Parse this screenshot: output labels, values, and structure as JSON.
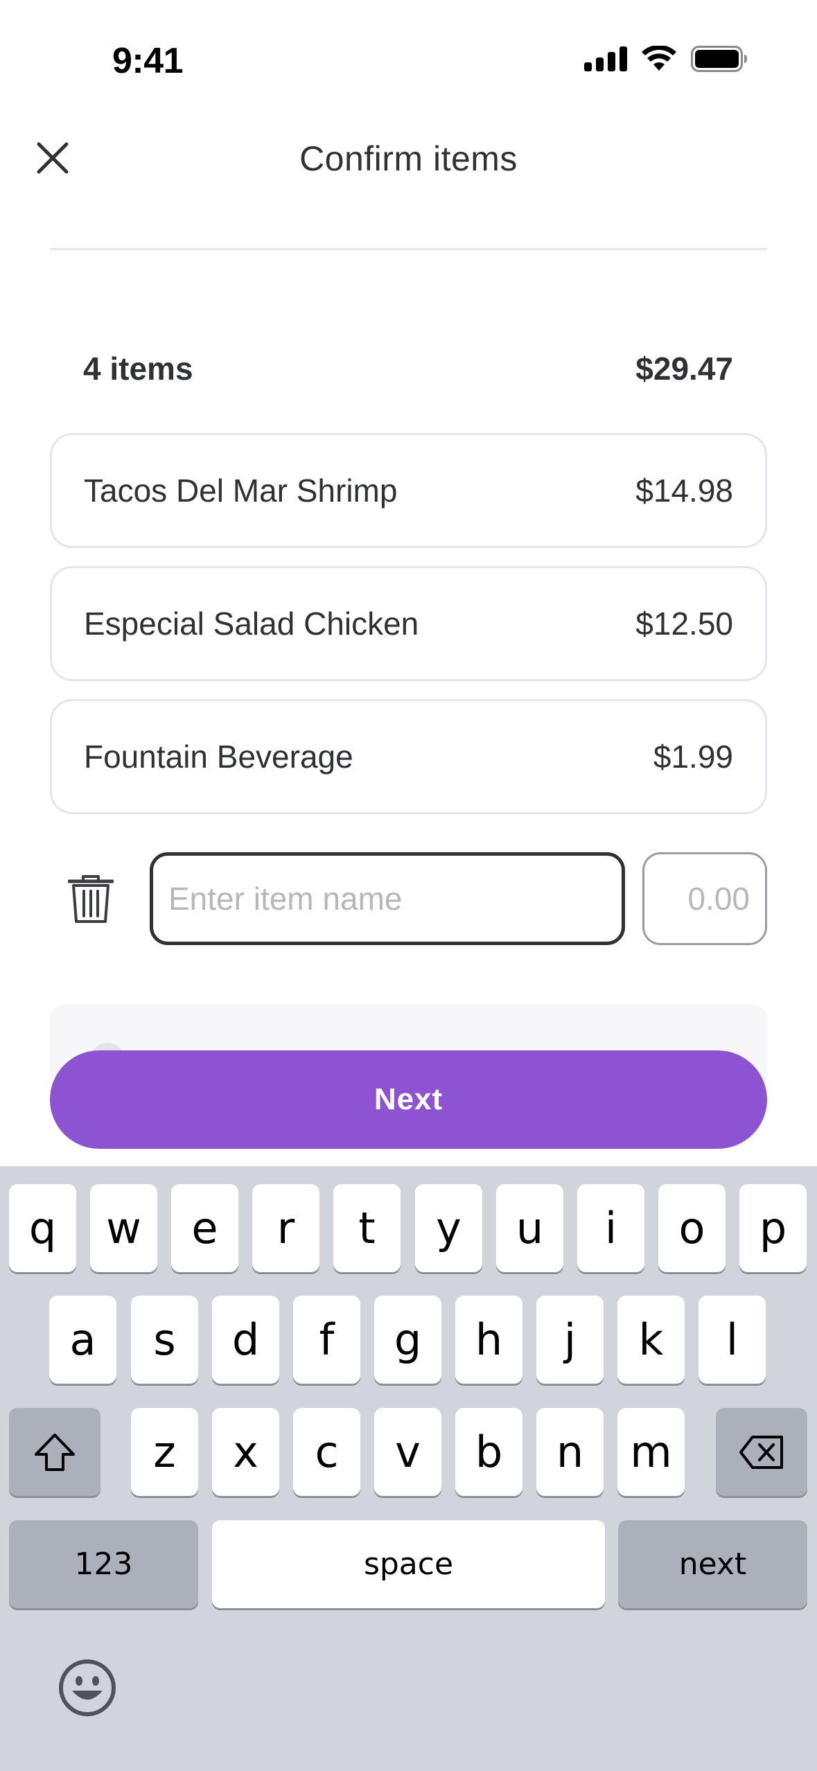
{
  "status_bar": {
    "time": "9:41"
  },
  "header": {
    "title": "Confirm items"
  },
  "summary": {
    "count": "4 items",
    "total": "$29.47"
  },
  "items": [
    {
      "name": "Tacos Del Mar Shrimp",
      "price": "$14.98"
    },
    {
      "name": "Especial Salad Chicken",
      "price": "$12.50"
    },
    {
      "name": "Fountain Beverage",
      "price": "$1.99"
    }
  ],
  "new_item": {
    "name_placeholder": "Enter item name",
    "price_placeholder": "0.00"
  },
  "next_button": {
    "label": "Next"
  },
  "colors": {
    "accent": "#8e53d2",
    "text": "#2f3135",
    "keyboard_bg": "#d1d4db"
  },
  "keyboard": {
    "row1": [
      "q",
      "w",
      "e",
      "r",
      "t",
      "y",
      "u",
      "i",
      "o",
      "p"
    ],
    "row2": [
      "a",
      "s",
      "d",
      "f",
      "g",
      "h",
      "j",
      "k",
      "l"
    ],
    "row3": [
      "z",
      "x",
      "c",
      "v",
      "b",
      "n",
      "m"
    ],
    "numbers_label": "123",
    "space_label": "space",
    "return_label": "next",
    "icons": {
      "shift": "shift-icon",
      "delete": "delete-icon",
      "emoji": "emoji-icon"
    }
  }
}
